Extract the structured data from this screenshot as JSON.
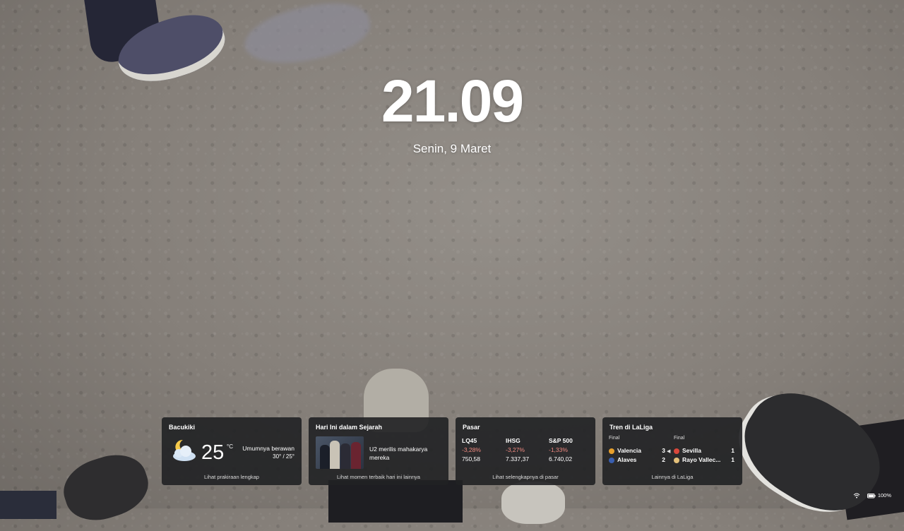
{
  "clock": {
    "time": "21.09",
    "date": "Senin, 9 Maret"
  },
  "widgets": {
    "weather": {
      "title": "Bacukiki",
      "temp": "25",
      "unit": "°C",
      "condition": "Umumnya berawan",
      "hilo": "30° / 25°",
      "link": "Lihat prakiraan lengkap",
      "icon": "partly-cloudy-night-icon"
    },
    "history": {
      "title": "Hari Ini dalam Sejarah",
      "text": "U2 merilis mahakarya mereka",
      "link": "Lihat momen terbaik hari ini lainnya"
    },
    "market": {
      "title": "Pasar",
      "items": [
        {
          "name": "LQ45",
          "change": "-3,28%",
          "value": "750,58"
        },
        {
          "name": "IHSG",
          "change": "-3,27%",
          "value": "7.337,37"
        },
        {
          "name": "S&P 500",
          "change": "-1,33%",
          "value": "6.740,02"
        }
      ],
      "link": "Lihat selengkapnya di pasar",
      "down_color": "#f28b82"
    },
    "laliga": {
      "title": "Tren di LaLiga",
      "matches": [
        {
          "status": "Final",
          "home": "Valencia",
          "home_score": "3",
          "away": "Alaves",
          "away_score": "2"
        },
        {
          "status": "Final",
          "home": "Sevilla",
          "home_score": "1",
          "away": "Rayo Vallec...",
          "away_score": "1"
        }
      ],
      "link": "Lainnya di LaLiga"
    }
  },
  "tray": {
    "battery": "100%",
    "wifi_icon": "wifi-icon",
    "battery_icon": "battery-icon"
  }
}
